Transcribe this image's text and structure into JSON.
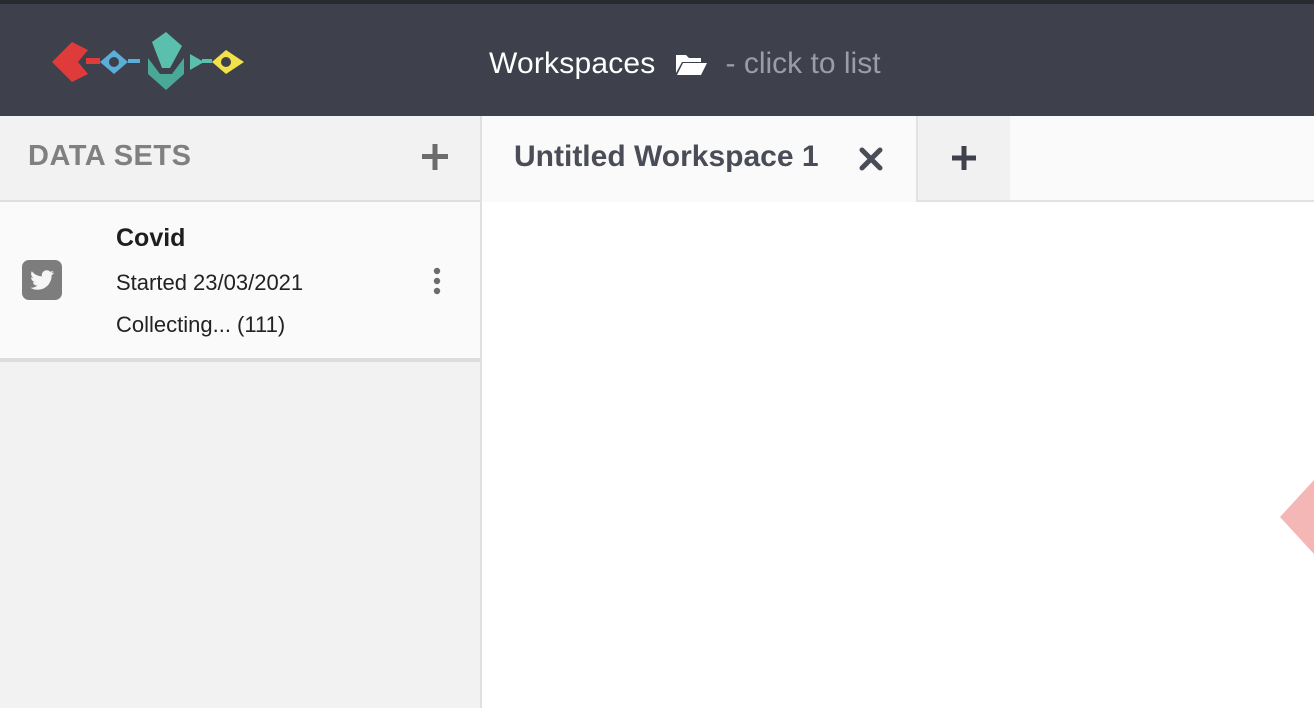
{
  "header": {
    "logo_icon": "cosmos-logo-icon",
    "title": "Workspaces",
    "folder_icon": "folder-open-icon",
    "hint": "- click to list"
  },
  "sidebar": {
    "title": "DATA SETS",
    "add_icon": "plus-icon",
    "datasets": [
      {
        "icon": "twitter-icon",
        "name": "Covid",
        "started": "Started 23/03/2021",
        "status": "Collecting... (111)",
        "menu_icon": "kebab-menu-icon"
      }
    ]
  },
  "tabs": {
    "items": [
      {
        "label": "Untitled Workspace 1",
        "close_icon": "close-icon"
      }
    ],
    "add_icon": "plus-icon"
  },
  "colors": {
    "topbar": "#3e404c",
    "sidebar": "#f2f2f2",
    "logo_red": "#e03b3b",
    "logo_blue": "#5aaed8",
    "logo_teal": "#5bbfae",
    "logo_yellow": "#f2e14a"
  }
}
